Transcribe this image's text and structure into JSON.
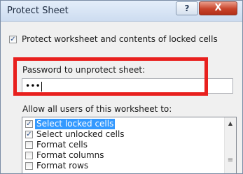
{
  "dialog": {
    "title": "Protect Sheet",
    "help_label": "?",
    "close_label": "X"
  },
  "protect": {
    "checked": true,
    "check_mark": "✓",
    "label": "Protect worksheet and contents of locked cells"
  },
  "password": {
    "label": "Password to unprotect sheet:",
    "value": "•••"
  },
  "allow": {
    "label": "Allow all users of this worksheet to:",
    "items": [
      {
        "label": "Select locked cells",
        "checked": true,
        "selected": true
      },
      {
        "label": "Select unlocked cells",
        "checked": true,
        "selected": false
      },
      {
        "label": "Format cells",
        "checked": false,
        "selected": false
      },
      {
        "label": "Format columns",
        "checked": false,
        "selected": false
      },
      {
        "label": "Format rows",
        "checked": false,
        "selected": false
      }
    ]
  },
  "scrollbar": {
    "up_arrow": "▲",
    "grip": "≡"
  },
  "colors": {
    "highlight_box": "#e8201e",
    "selection": "#3399ff",
    "close_button": "#c8432a"
  }
}
